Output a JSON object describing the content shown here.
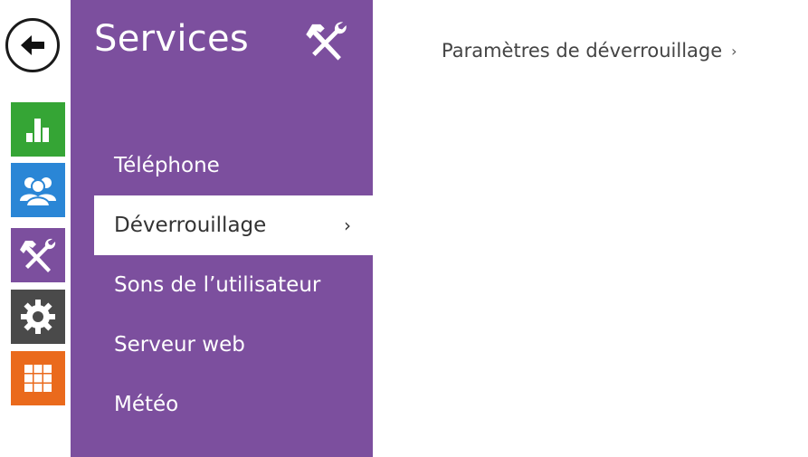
{
  "rail": {
    "back_icon": "arrow-left-icon",
    "tiles": [
      {
        "name": "status",
        "icon": "bar-chart-icon",
        "color": "#35a535"
      },
      {
        "name": "users",
        "icon": "users-icon",
        "color": "#2a86d6"
      },
      {
        "name": "services",
        "icon": "tools-icon",
        "color": "#7c4f9e"
      },
      {
        "name": "settings",
        "icon": "gear-icon",
        "color": "#4a4a4a"
      },
      {
        "name": "apps",
        "icon": "grid-icon",
        "color": "#ea6a1c"
      }
    ]
  },
  "panel": {
    "title": "Services",
    "title_icon": "tools-icon",
    "color": "#7c4f9e",
    "items": [
      {
        "label": "Téléphone"
      },
      {
        "label": "Déverrouillage",
        "active": true
      },
      {
        "label": "Sons de l’utilisateur"
      },
      {
        "label": "Serveur web"
      },
      {
        "label": "Météo"
      }
    ],
    "active_chevron": "›"
  },
  "content": {
    "link_label": "Paramètres de déverrouillage",
    "link_chevron": "›"
  }
}
